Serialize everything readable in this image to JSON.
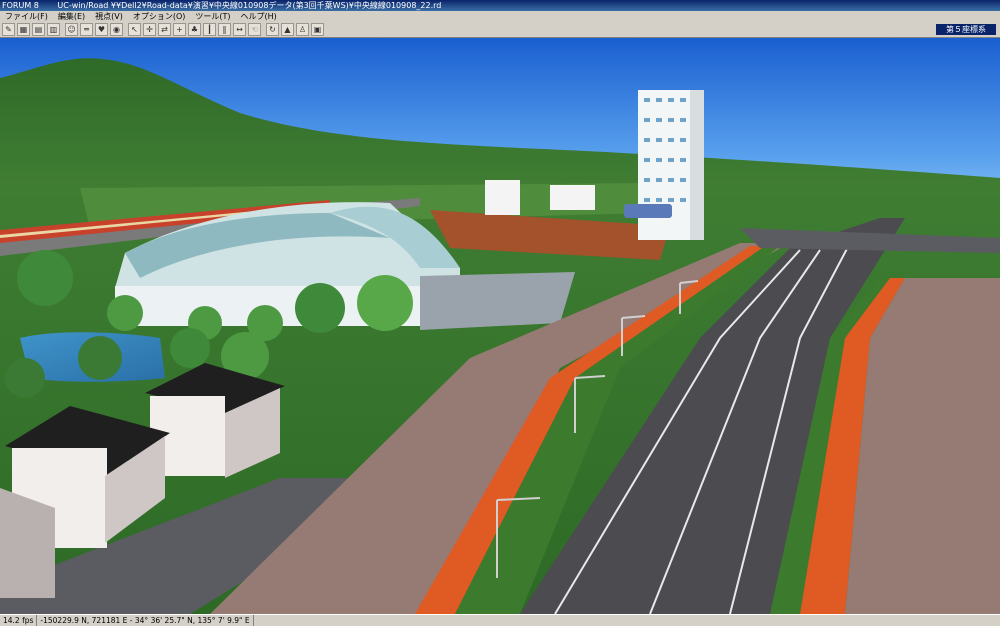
{
  "window": {
    "app_name": "FORUM 8",
    "title": "UC-win/Road   ¥¥Dell2¥Road-data¥演習¥中央線010908データ(第3回千葉WS)¥中央線線010908_22.rd"
  },
  "menu": [
    "ファイル(F)",
    "編集(E)",
    "視点(V)",
    "オプション(O)",
    "ツール(T)",
    "ヘルプ(H)"
  ],
  "coordinate_system": "第５座標系",
  "status": {
    "fps": "14.2 fps",
    "coords": "-150229.9 N, 721181 E  -  34°  36' 25.7\" N, 135°  7' 9.9\" E"
  },
  "icons": [
    "pencil-icon",
    "grid-icon",
    "chart-icon",
    "table-icon",
    "face-icon",
    "road-icon",
    "heart-icon",
    "world-icon",
    "cursor-icon",
    "cross-icon",
    "arrows-icon",
    "road-plus-icon",
    "tree-icon",
    "pole-icon",
    "pause-icon",
    "left-right-icon",
    "hand-icon",
    "rotate-icon",
    "terrain-icon",
    "walker-icon",
    "camera-icon"
  ]
}
